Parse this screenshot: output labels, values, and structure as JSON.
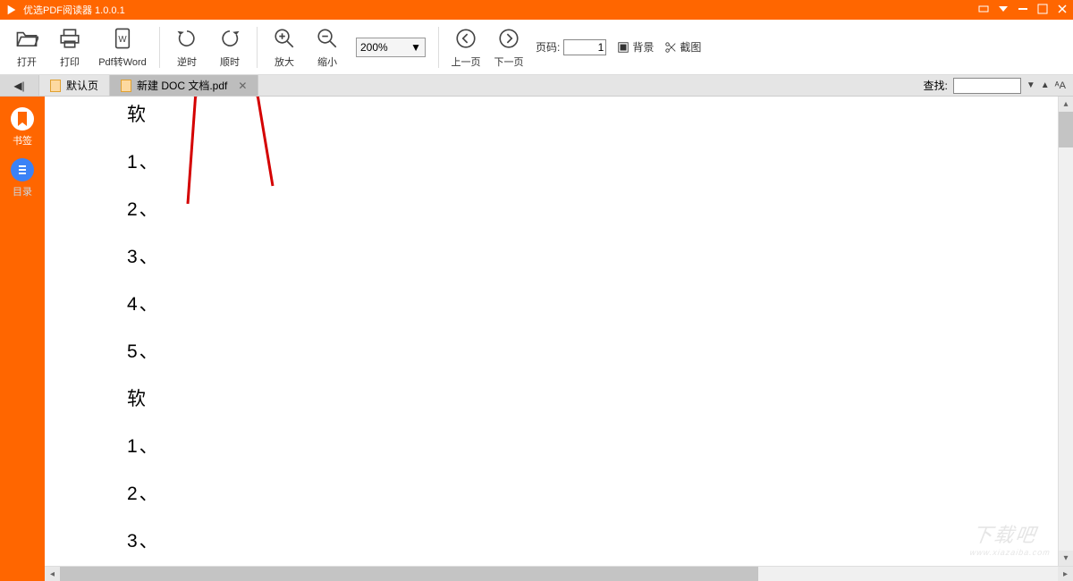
{
  "title": "优选PDF阅读器 1.0.0.1",
  "toolbar": {
    "open": "打开",
    "print": "打印",
    "pdf2word": "Pdf转Word",
    "rotate_ccw": "逆时",
    "rotate_cw": "顺时",
    "zoom_in": "放大",
    "zoom_out": "缩小",
    "zoom_value": "200%",
    "prev_page": "上一页",
    "next_page": "下一页",
    "page_label": "页码:",
    "page_value": "1",
    "background": "背景",
    "screenshot": "截图"
  },
  "tabs": {
    "default_tab": "默认页",
    "file_tab": "新建 DOC 文档.pdf"
  },
  "search": {
    "label": "查找:",
    "value": ""
  },
  "sidebar": {
    "bookmarks": "书签",
    "toc": "目录"
  },
  "document": {
    "lines": [
      "软",
      "1、",
      "2、",
      "3、",
      "4、",
      "5、",
      "软",
      "1、",
      "2、",
      "3、"
    ]
  },
  "watermark": {
    "big": "下载吧",
    "small": "www.xiazaiba.com"
  }
}
